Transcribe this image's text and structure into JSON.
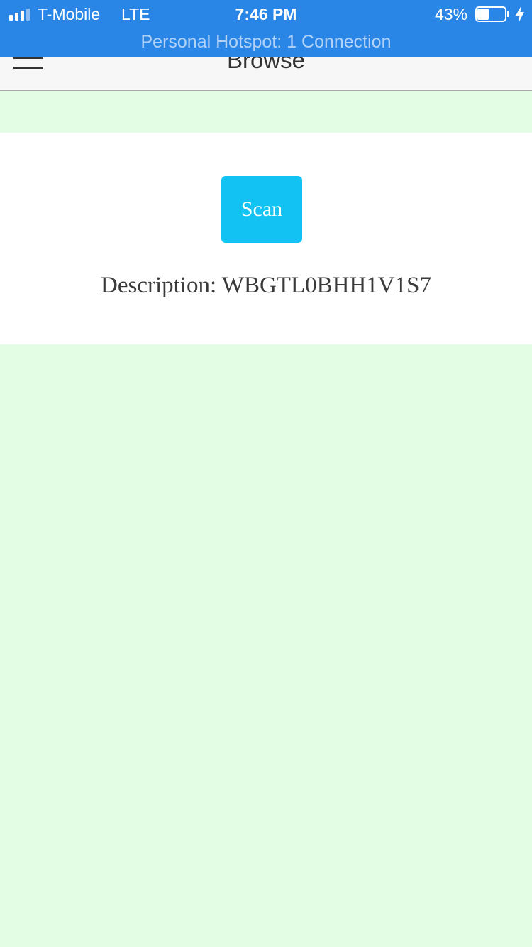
{
  "status_bar": {
    "carrier": "T-Mobile",
    "network": "LTE",
    "time": "7:46 PM",
    "battery_percent": "43%",
    "battery_level": 0.43,
    "signal_bars": 3,
    "hotspot": "Personal Hotspot: 1 Connection",
    "background_color": "#2a86e6"
  },
  "nav_bar": {
    "title": "Browse",
    "menu_icon": "hamburger-menu-icon"
  },
  "main": {
    "scan_button_label": "Scan",
    "description": "Description: WBGTL0BHH1V1S7",
    "accent_color": "#12c2f3",
    "page_background": "#e3fde5"
  }
}
